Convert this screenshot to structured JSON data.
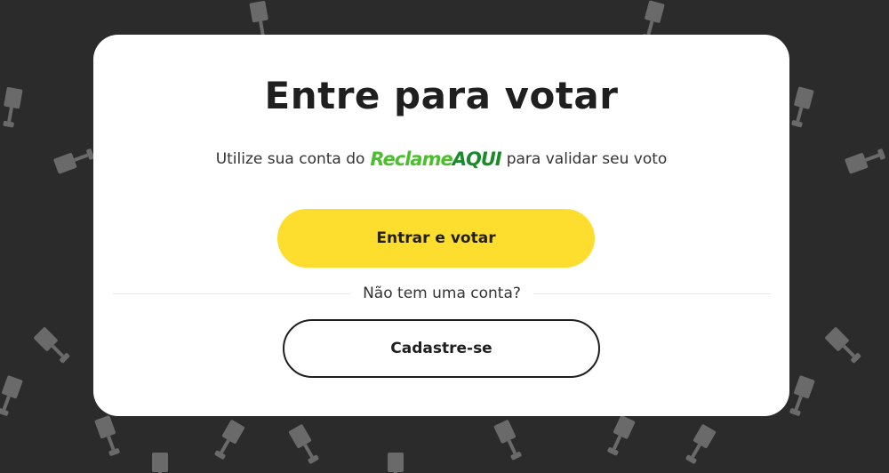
{
  "modal": {
    "title": "Entre para votar",
    "subtitle_before": "Utilize sua conta do",
    "brand_reclame": "Reclame",
    "brand_aqui": "AQUI",
    "subtitle_after": "para validar seu voto",
    "primary_button": "Entrar e votar",
    "divider_text": "Não tem uma conta?",
    "secondary_button": "Cadastre-se"
  },
  "colors": {
    "background": "#2b2b2b",
    "card": "#ffffff",
    "primary_button": "#fddd2e",
    "brand_light_green": "#4cbf2e",
    "brand_dark_green": "#1a8a2a",
    "pattern_icon": "#6a6a6a"
  },
  "background_pattern_icon": "trophy-icon"
}
